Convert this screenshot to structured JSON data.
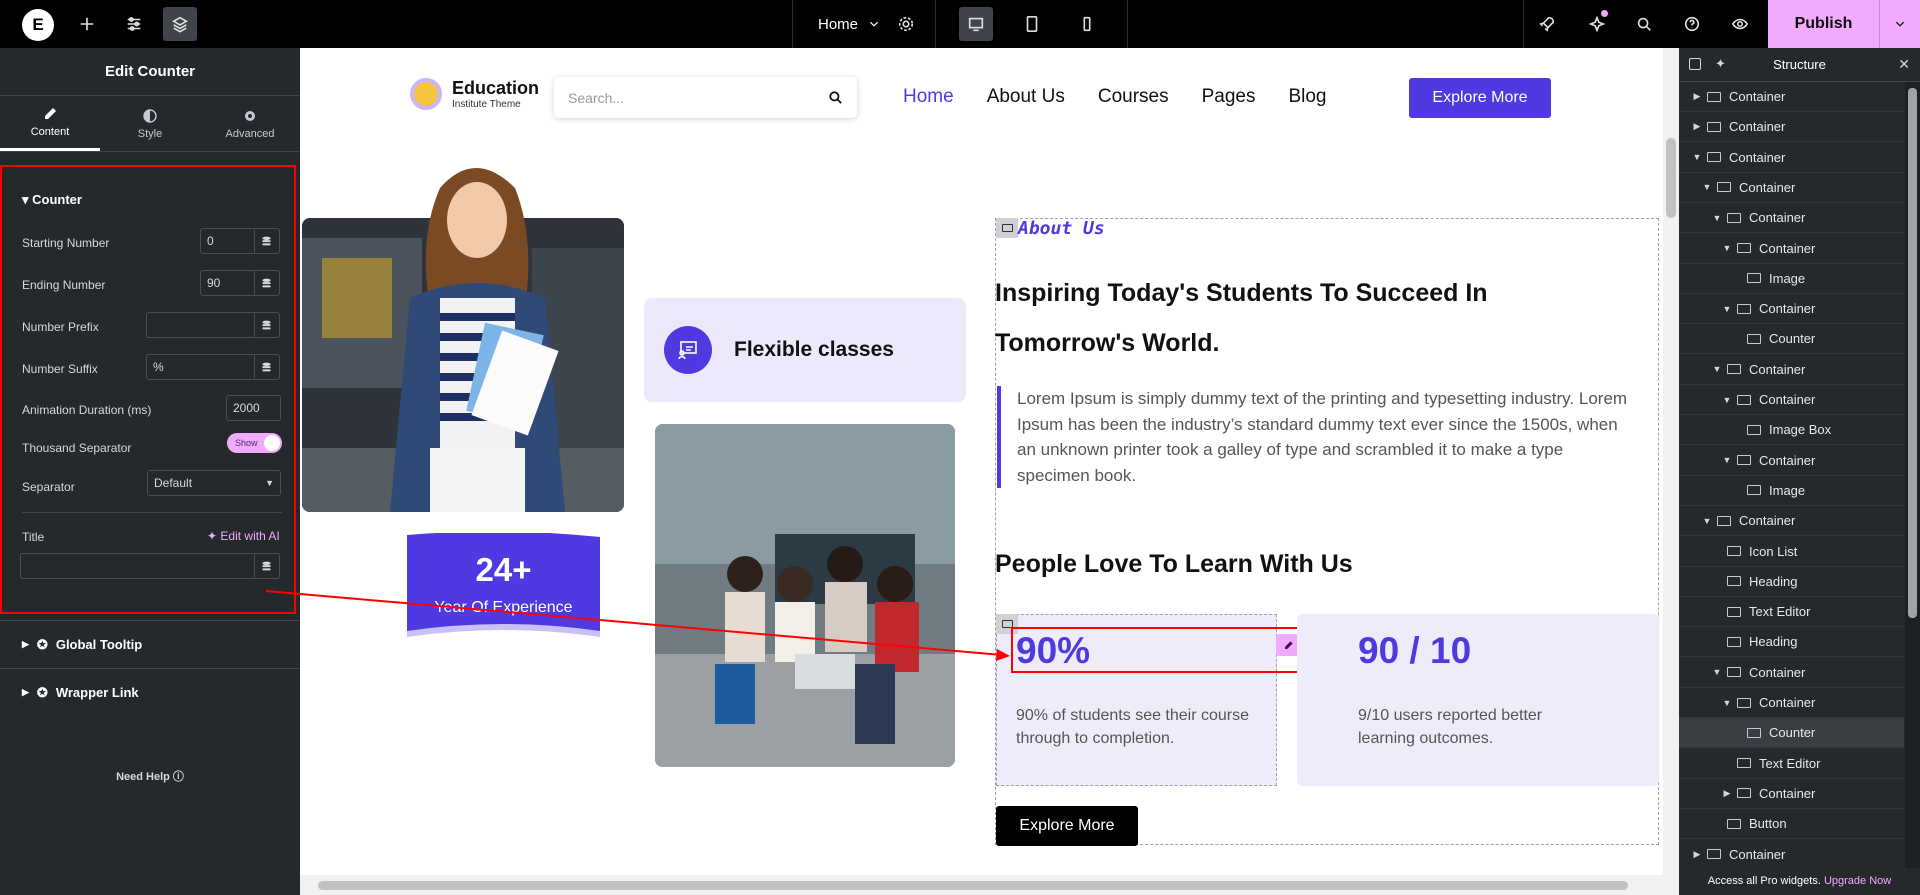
{
  "topbar": {
    "page_selector": "Home",
    "publish_label": "Publish"
  },
  "panel": {
    "title": "Edit Counter",
    "tabs": [
      {
        "label": "Content"
      },
      {
        "label": "Style"
      },
      {
        "label": "Advanced"
      }
    ],
    "section_title": "Counter",
    "controls": {
      "starting_number_label": "Starting Number",
      "starting_number_value": "0",
      "ending_number_label": "Ending Number",
      "ending_number_value": "90",
      "number_prefix_label": "Number Prefix",
      "number_prefix_value": "",
      "number_suffix_label": "Number Suffix",
      "number_suffix_value": "%",
      "animation_duration_label": "Animation Duration (ms)",
      "animation_duration_value": "2000",
      "thousand_separator_label": "Thousand Separator",
      "thousand_separator_toggle": "Show",
      "separator_label": "Separator",
      "separator_value": "Default",
      "title_label": "Title",
      "edit_ai_label": "Edit with AI",
      "title_value": ""
    },
    "accordions": [
      {
        "label": "Global Tooltip"
      },
      {
        "label": "Wrapper Link"
      }
    ],
    "need_help": "Need Help"
  },
  "site": {
    "logo_title": "Education",
    "logo_subtitle": "Institute Theme",
    "search_placeholder": "Search...",
    "nav": [
      {
        "label": "Home"
      },
      {
        "label": "About Us"
      },
      {
        "label": "Courses"
      },
      {
        "label": "Pages"
      },
      {
        "label": "Blog"
      }
    ],
    "explore_label": "Explore More",
    "card_label": "Flexible classes",
    "badge_number": "24+",
    "badge_text": "Year Of Experience",
    "about_tag": "About Us",
    "heading": "Inspiring Today's Students To Succeed In Tomorrow's World.",
    "paragraph": "Lorem Ipsum is simply dummy text of the printing and typesetting industry. Lorem Ipsum has been the industry’s standard dummy text ever since the 1500s, when an unknown printer took a galley of type and scrambled it to make a type specimen book.",
    "subheading": "People Love To Learn With Us",
    "stats": [
      {
        "number": "90%",
        "text": "90% of students see their course through to completion."
      },
      {
        "number": "90 / 10",
        "text": "9/10 users reported better learning outcomes."
      }
    ],
    "explore_black_label": "Explore More"
  },
  "structure": {
    "title": "Structure",
    "items": [
      {
        "label": "Container"
      },
      {
        "label": "Container"
      },
      {
        "label": "Container"
      },
      {
        "label": "Container"
      },
      {
        "label": "Container"
      },
      {
        "label": "Container"
      },
      {
        "label": "Image"
      },
      {
        "label": "Container"
      },
      {
        "label": "Counter"
      },
      {
        "label": "Container"
      },
      {
        "label": "Container"
      },
      {
        "label": "Image Box"
      },
      {
        "label": "Container"
      },
      {
        "label": "Image"
      },
      {
        "label": "Container"
      },
      {
        "label": "Icon List"
      },
      {
        "label": "Heading"
      },
      {
        "label": "Text Editor"
      },
      {
        "label": "Heading"
      },
      {
        "label": "Container"
      },
      {
        "label": "Container"
      },
      {
        "label": "Counter"
      },
      {
        "label": "Text Editor"
      },
      {
        "label": "Container"
      },
      {
        "label": "Button"
      },
      {
        "label": "Container"
      }
    ],
    "promo_text": "Access all Pro widgets.",
    "promo_link": "Upgrade Now"
  }
}
